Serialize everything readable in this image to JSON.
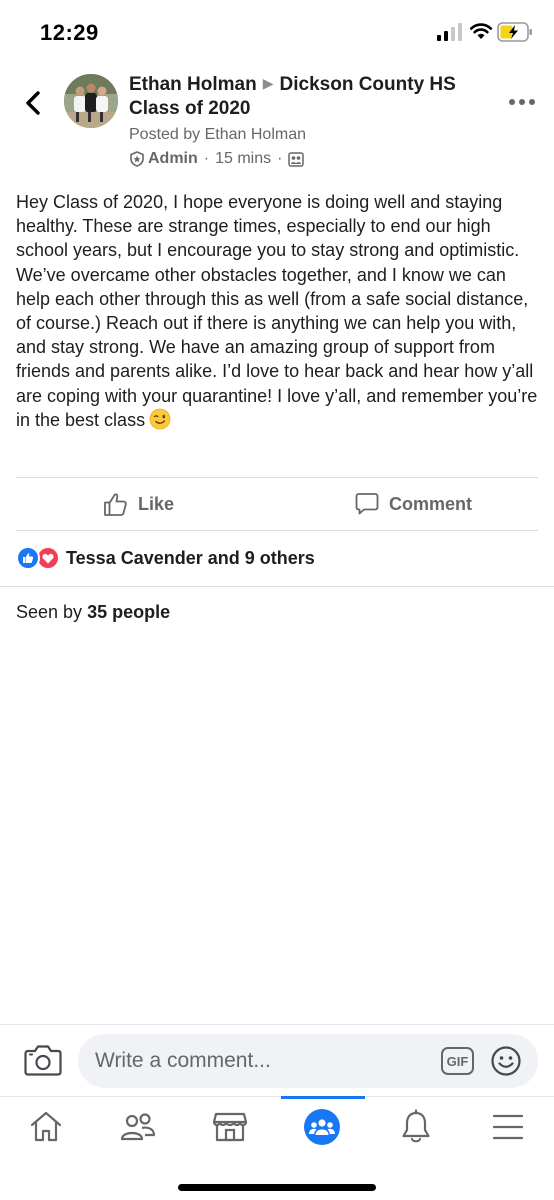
{
  "status_bar": {
    "time": "12:29",
    "icons": [
      "signal-icon",
      "wifi-icon",
      "battery-charging-icon"
    ]
  },
  "post": {
    "author": "Ethan Holman",
    "group": "Dickson County HS Class of 2020",
    "posted_by": "Posted by Ethan Holman",
    "role": "Admin",
    "time": "15 mins",
    "privacy_icon": "group-members-icon",
    "body": "Hey Class of 2020, I hope everyone is doing well and staying healthy. These are strange times, especially to end our high school years, but I encourage you to stay strong and optimistic. We’ve overcame other obstacles together, and I know we can help each other through this as well (from a safe social distance, of course.) Reach out if there is anything we can help you with, and stay strong. We have an amazing group of support from friends and parents alike. I’d love to hear back and hear how y’all are coping with your quarantine! I love y’all, and remember you’re in the best class",
    "body_emoji": "winking-face-emoji"
  },
  "actions": {
    "like_label": "Like",
    "comment_label": "Comment"
  },
  "reactions": {
    "summary": "Tessa Cavender and 9 others",
    "types": [
      "like",
      "love"
    ]
  },
  "seen_by": {
    "prefix": "Seen by",
    "count_text": "35 people"
  },
  "comment_bar": {
    "placeholder": "Write a comment...",
    "gif_label": "GIF"
  },
  "tab_bar": {
    "tabs": [
      "home-icon",
      "friends-icon",
      "marketplace-icon",
      "groups-icon",
      "notifications-icon",
      "menu-icon"
    ],
    "active_tab": "groups-icon"
  },
  "colors": {
    "accent": "#1877f2",
    "love": "#f33e58",
    "secondary_text": "#65676b"
  }
}
